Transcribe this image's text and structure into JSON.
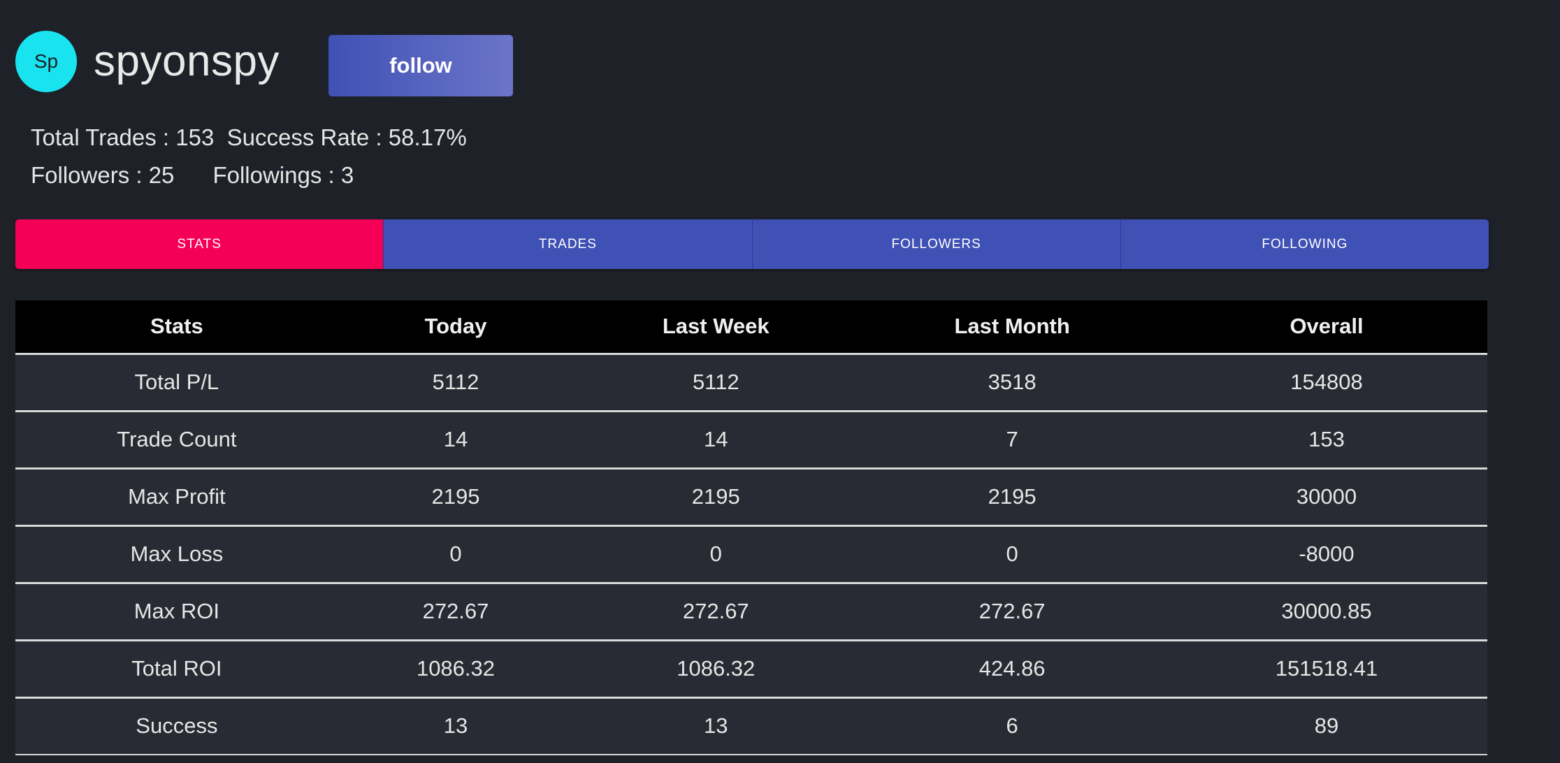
{
  "profile": {
    "avatar_initials": "Sp",
    "username": "spyonspy",
    "follow_label": "follow",
    "avatar_color": "#18e3ef"
  },
  "summary": {
    "total_trades": "Total Trades : 153",
    "success_rate": "Success Rate : 58.17%",
    "followers": "Followers : 25",
    "followings": "Followings : 3"
  },
  "tabs": [
    {
      "label": "STATS",
      "active": true
    },
    {
      "label": "TRADES",
      "active": false
    },
    {
      "label": "FOLLOWERS",
      "active": false
    },
    {
      "label": "FOLLOWING",
      "active": false
    }
  ],
  "colors": {
    "background": "#1f2128",
    "tab_active": "#f50057",
    "tab_inactive": "#3f51b5",
    "table_header": "#000000"
  },
  "table": {
    "headers": [
      "Stats",
      "Today",
      "Last Week",
      "Last Month",
      "Overall"
    ],
    "rows": [
      [
        "Total P/L",
        "5112",
        "5112",
        "3518",
        "154808"
      ],
      [
        "Trade Count",
        "14",
        "14",
        "7",
        "153"
      ],
      [
        "Max Profit",
        "2195",
        "2195",
        "2195",
        "30000"
      ],
      [
        "Max Loss",
        "0",
        "0",
        "0",
        "-8000"
      ],
      [
        "Max ROI",
        "272.67",
        "272.67",
        "272.67",
        "30000.85"
      ],
      [
        "Total ROI",
        "1086.32",
        "1086.32",
        "424.86",
        "151518.41"
      ],
      [
        "Success",
        "13",
        "13",
        "6",
        "89"
      ]
    ]
  }
}
